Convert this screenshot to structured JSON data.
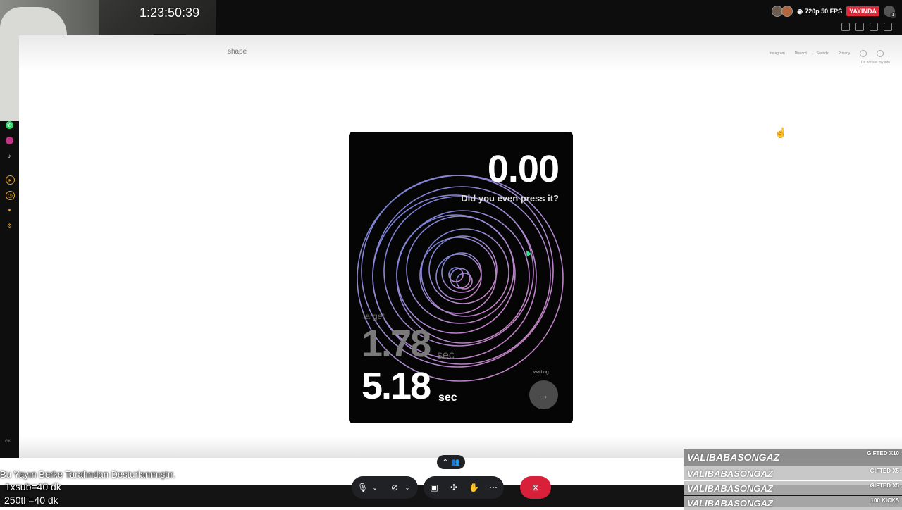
{
  "stream": {
    "timer": "1:23:50:39",
    "quality": "720p 50 FPS",
    "live_label": "YAYINDA",
    "notifications": "1"
  },
  "site": {
    "name": "shape",
    "nav": [
      "Instagram",
      "Discord",
      "Sounds",
      "Privacy"
    ],
    "do_not_sell": "Do not sell my info"
  },
  "game": {
    "time_value": "0.00",
    "message": "Did you even press it?",
    "target_label": "target",
    "target_value": "1.78",
    "target_unit": "sec",
    "result_value": "5.18",
    "result_unit": "sec",
    "status": "waiting",
    "go_icon": "arrow-right-icon"
  },
  "overlay": {
    "credit": "Bu Yayın Berke Tarafından Desturlanmıştır.",
    "rule1": "1xsub=40 dk",
    "rule2": "250tl =40 dk"
  },
  "gifts": [
    {
      "name": "VALIBABASONGAZ",
      "tag": "GIFTED X10"
    },
    {
      "name": "VALIBABASONGAZ",
      "tag": "GIFTED X5"
    },
    {
      "name": "VALIBABASONGAZ",
      "tag": "GIFTED X5"
    },
    {
      "name": "VALIBABASONGAZ",
      "tag": "100 KICKS"
    }
  ],
  "sidebar_icons": [
    "whatsapp-icon",
    "instagram-icon",
    "tiktok-icon",
    "play-icon",
    "clock-icon",
    "puzzle-icon",
    "gear-icon"
  ],
  "sidebar_label": "GK",
  "colors": {
    "live": "#e0283a",
    "end_call": "#d9203a",
    "ring_purple": "#a98be0",
    "ring_pink": "#e08ad0"
  }
}
